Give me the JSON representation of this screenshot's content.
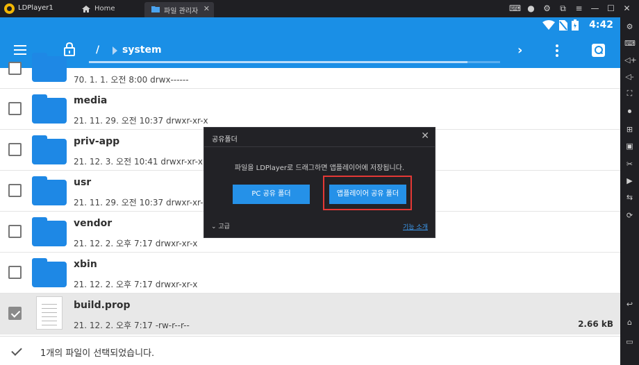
{
  "titlebar": {
    "app_name": "LDPlayer1",
    "tabs": [
      {
        "label": "Home",
        "icon": "home-icon"
      },
      {
        "label": "파일 관리자",
        "icon": "folder-icon"
      }
    ],
    "controls": [
      "gamepad-icon",
      "account-icon",
      "settings-icon",
      "restore-icon",
      "menu-icon",
      "minimize-icon",
      "maximize-icon",
      "close-icon"
    ]
  },
  "statusbar": {
    "time": "4:42",
    "icons": [
      "wifi-icon",
      "no-sim-icon",
      "battery-icon"
    ]
  },
  "appbar": {
    "root": "/",
    "path": "system",
    "progress": 0.92
  },
  "files": [
    {
      "name": "",
      "meta": "70. 1. 1. 오전 8:00  drwx------",
      "type": "folder",
      "checked": false,
      "partial": true
    },
    {
      "name": "media",
      "meta": "21. 11. 29. 오전 10:37  drwxr-xr-x",
      "type": "folder",
      "checked": false
    },
    {
      "name": "priv-app",
      "meta": "21. 12. 3. 오전 10:41  drwxr-xr-x",
      "type": "folder",
      "checked": false
    },
    {
      "name": "usr",
      "meta": "21. 11. 29. 오전 10:37  drwxr-xr-x",
      "type": "folder",
      "checked": false
    },
    {
      "name": "vendor",
      "meta": "21. 12. 2. 오후 7:17  drwxr-xr-x",
      "type": "folder",
      "checked": false
    },
    {
      "name": "xbin",
      "meta": "21. 12. 2. 오후 7:17  drwxr-xr-x",
      "type": "folder",
      "checked": false
    },
    {
      "name": "build.prop",
      "meta": "21. 12. 2. 오후 7:17  -rw-r--r--",
      "type": "file",
      "checked": true,
      "size": "2.66 kB"
    }
  ],
  "bottombar": {
    "text": "1개의 파일이 선택되었습니다."
  },
  "dialog": {
    "title": "공유폴더",
    "message": "파일을 LDPlayer로 드래그하면 앱플레이어에 저장됩니다.",
    "pc_button": "PC 공유 폴더",
    "app_button": "앱플레이어 공유 폴더",
    "advanced": "고급",
    "intro_link": "기능 소개"
  },
  "colors": {
    "accent": "#1a8fe6",
    "folder": "#1e88e5",
    "highlight": "#e53935"
  },
  "rightbar": [
    "settings-icon",
    "keyboard-icon",
    "volume-up-icon",
    "volume-down-icon",
    "screenshot-icon",
    "record-icon",
    "add-app-icon",
    "apk-icon",
    "cut-icon",
    "video-icon",
    "sync-icon",
    "shake-icon",
    "back-icon",
    "home-icon",
    "recent-apps-icon"
  ]
}
